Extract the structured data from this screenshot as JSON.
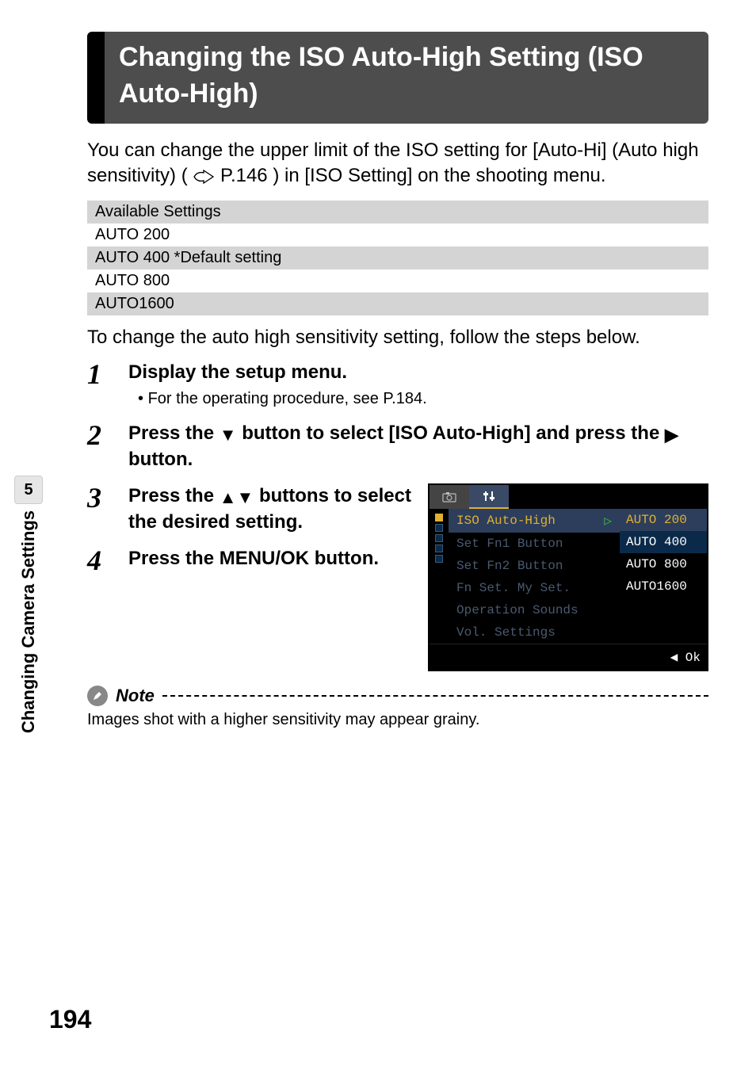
{
  "page_number": "194",
  "sidebar": {
    "chapter_number": "5",
    "chapter_title": "Changing Camera Settings"
  },
  "title": "Changing the ISO Auto-High Setting (ISO Auto-High)",
  "intro_a": "You can change the upper limit of the ISO setting for [Auto-Hi] (Auto high sensitivity) (",
  "intro_ref": "P.146",
  "intro_b": ") in [ISO Setting] on the shooting menu.",
  "table_header": "Available Settings",
  "table_rows": [
    "AUTO 200",
    "AUTO 400 *Default setting",
    "AUTO 800",
    "AUTO1600"
  ],
  "sentence": "To change the auto high sensitivity setting, follow the steps below.",
  "steps": {
    "s1": {
      "num": "1",
      "text": "Display the setup menu.",
      "sub_prefix": "• ",
      "sub": "For the operating procedure, see P.184."
    },
    "s2": {
      "num": "2",
      "text_a": "Press the ",
      "text_b": " button to select [ISO Auto-High] and press the ",
      "text_c": " button."
    },
    "s3": {
      "num": "3",
      "text_a": "Press the ",
      "text_b": " buttons to select the desired setting."
    },
    "s4": {
      "num": "4",
      "text": "Press the MENU/OK button."
    }
  },
  "lcd": {
    "selected": "ISO Auto-High",
    "items": [
      "Set Fn1 Button",
      "Set Fn2 Button",
      "Fn Set. My Set.",
      "Operation Sounds",
      "Vol. Settings"
    ],
    "options": [
      "AUTO 200",
      "AUTO 400",
      "AUTO 800",
      "AUTO1600"
    ],
    "foot_label": "Ok"
  },
  "note": {
    "label": "Note",
    "body": "Images shot with a higher sensitivity may appear grainy."
  }
}
